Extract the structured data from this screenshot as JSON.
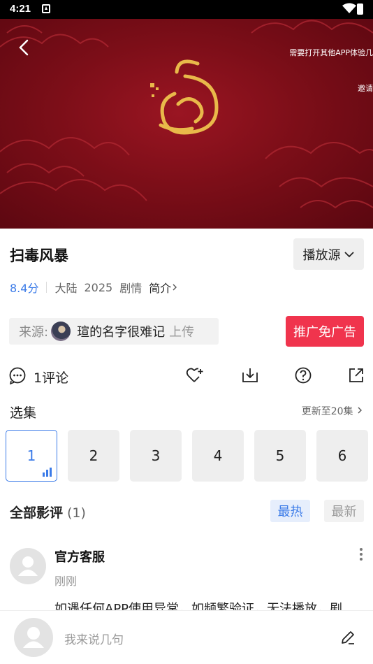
{
  "status_bar": {
    "time": "4:21"
  },
  "player": {
    "marquee_line1": "需要打开其他APP体验几",
    "marquee_line2": "邀请"
  },
  "detail": {
    "title": "扫毒风暴",
    "source_button": "播放源",
    "score": "8.4分",
    "region": "大陆",
    "year": "2025",
    "genre": "剧情",
    "intro_label": "简介"
  },
  "uploader": {
    "source_label": "来源:",
    "name": "瑄的名字很难记",
    "upload_label": "上传"
  },
  "promo_button": "推广免广告",
  "actions": {
    "comment_count": "1评论"
  },
  "episodes": {
    "title": "选集",
    "update_label": "更新至20集",
    "items": [
      "1",
      "2",
      "3",
      "4",
      "5",
      "6"
    ]
  },
  "reviews": {
    "title": "全部影评",
    "count": "(1)",
    "sort_hot": "最热",
    "sort_new": "最新",
    "items": [
      {
        "author": "官方客服",
        "time": "刚刚",
        "text": "如遇任何APP使用异常，如频繁验证，无法播放，剧"
      }
    ]
  },
  "comment_bar": {
    "placeholder": "我来说几句"
  },
  "colors": {
    "accent": "#3b7be8",
    "promo": "#f0344d",
    "player_bg": "#7c0e18"
  }
}
